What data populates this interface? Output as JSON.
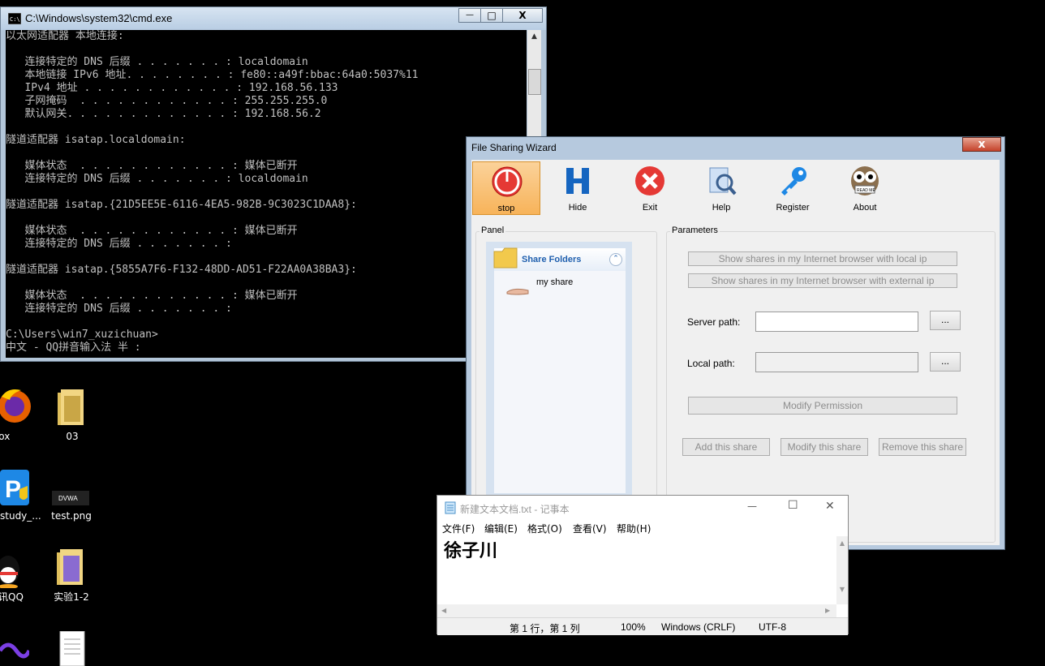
{
  "cmd": {
    "title": "C:\\Windows\\system32\\cmd.exe",
    "buttons": {
      "minimize": "—",
      "maximize": "□",
      "close": "X"
    },
    "lines": [
      "以太网适配器 本地连接:",
      "",
      "   连接特定的 DNS 后缀 . . . . . . . : localdomain",
      "   本地链接 IPv6 地址. . . . . . . . : fe80::a49f:bbac:64a0:5037%11",
      "   IPv4 地址 . . . . . . . . . . . . : 192.168.56.133",
      "   子网掩码  . . . . . . . . . . . . : 255.255.255.0",
      "   默认网关. . . . . . . . . . . . . : 192.168.56.2",
      "",
      "隧道适配器 isatap.localdomain:",
      "",
      "   媒体状态  . . . . . . . . . . . . : 媒体已断开",
      "   连接特定的 DNS 后缀 . . . . . . . : localdomain",
      "",
      "隧道适配器 isatap.{21D5EE5E-6116-4EA5-982B-9C3023C1DAA8}:",
      "",
      "   媒体状态  . . . . . . . . . . . . : 媒体已断开",
      "   连接特定的 DNS 后缀 . . . . . . . :",
      "",
      "隧道适配器 isatap.{5855A7F6-F132-48DD-AD51-F22AA0A38BA3}:",
      "",
      "   媒体状态  . . . . . . . . . . . . : 媒体已断开",
      "   连接特定的 DNS 后缀 . . . . . . . :",
      "",
      "C:\\Users\\win7_xuzichuan>",
      "中文 - QQ拼音输入法 半 :"
    ]
  },
  "desktop": {
    "icons": [
      {
        "label": "refox"
      },
      {
        "label": "03"
      },
      {
        "label": "study_..."
      },
      {
        "label": "test.png"
      },
      {
        "label": "讯QQ"
      },
      {
        "label": "实验1-2"
      }
    ]
  },
  "wizard": {
    "title": "File Sharing Wizard",
    "close": "x",
    "toolbar": [
      {
        "label": "stop"
      },
      {
        "label": "Hide"
      },
      {
        "label": "Exit"
      },
      {
        "label": "Help"
      },
      {
        "label": "Register"
      },
      {
        "label": "About"
      }
    ],
    "panel": {
      "label": "Panel",
      "header": "Share Folders",
      "items": [
        "my share"
      ]
    },
    "params": {
      "label": "Parameters",
      "show_local": "Show shares in my Internet browser with local ip",
      "show_external": "Show shares in my Internet browser with external ip",
      "server_path_label": "Server path:",
      "local_path_label": "Local path:",
      "browse": "...",
      "modify_permission": "Modify Permission",
      "add": "Add this share",
      "modify": "Modify this share",
      "remove": "Remove this share"
    }
  },
  "notepad": {
    "title": "新建文本文档.txt - 记事本",
    "buttons": {
      "minimize": "—",
      "maximize": "☐",
      "close": "✕"
    },
    "menu": [
      "文件(F)",
      "编辑(E)",
      "格式(O)",
      "查看(V)",
      "帮助(H)"
    ],
    "content": "徐子川",
    "status": {
      "position": "第 1 行，第 1 列",
      "zoom": "100%",
      "eol": "Windows (CRLF)",
      "encoding": "UTF-8"
    }
  },
  "colors": {
    "console_text": "#c0c0c0",
    "accent": "#f7b35a",
    "link": "#1f5fae"
  }
}
